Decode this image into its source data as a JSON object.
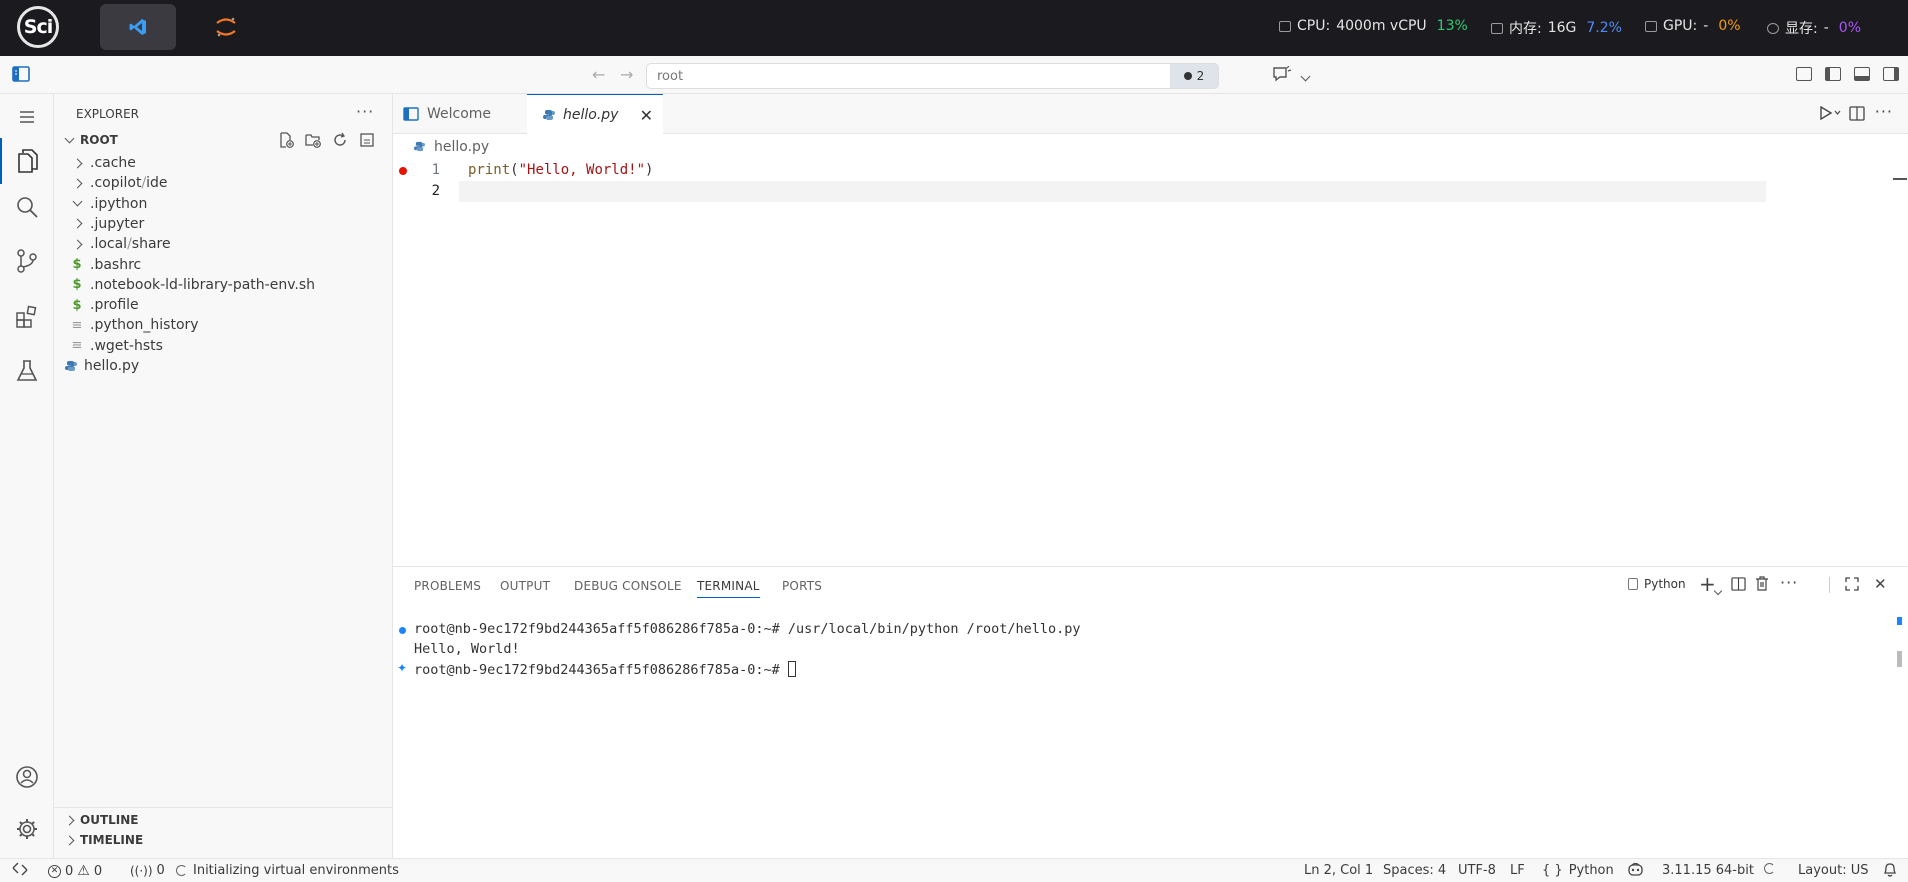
{
  "topbar": {
    "logo": "Sci",
    "cpu": {
      "label": "CPU:",
      "value": "4000m vCPU",
      "pct": "13%",
      "color": "#2ecc71"
    },
    "mem": {
      "label": "内存:",
      "value": "16G",
      "pct": "7.2%",
      "color": "#4d8bf7"
    },
    "gpu": {
      "label": "GPU:",
      "value": "-",
      "pct": "0%",
      "color": "#f39c12"
    },
    "vram": {
      "label": "显存:",
      "value": "-",
      "pct": "0%",
      "color": "#a855f7"
    }
  },
  "titlebar": {
    "search_text": "root",
    "badge_count": "2"
  },
  "sidebar": {
    "title": "EXPLORER",
    "root": "ROOT",
    "items": [
      {
        "label": ".cache",
        "kind": "folder"
      },
      {
        "label": ".copilot",
        "sub": "ide",
        "kind": "folder"
      },
      {
        "label": ".ipython",
        "kind": "folder-open"
      },
      {
        "label": ".jupyter",
        "kind": "folder"
      },
      {
        "label": ".local",
        "sub": "share",
        "kind": "folder"
      },
      {
        "label": ".bashrc",
        "kind": "shell"
      },
      {
        "label": ".notebook-ld-library-path-env.sh",
        "kind": "shell"
      },
      {
        "label": ".profile",
        "kind": "shell"
      },
      {
        "label": ".python_history",
        "kind": "text"
      },
      {
        "label": ".wget-hsts",
        "kind": "text"
      },
      {
        "label": "hello.py",
        "kind": "python"
      }
    ],
    "outline": "OUTLINE",
    "timeline": "TIMELINE"
  },
  "tabs": [
    {
      "label": "Welcome"
    },
    {
      "label": "hello.py"
    }
  ],
  "breadcrumb": "hello.py",
  "editor": {
    "lines": [
      {
        "num": "1",
        "code_fn": "print",
        "code_open": "(",
        "code_str": "\"Hello, World!\"",
        "code_close": ")"
      },
      {
        "num": "2"
      }
    ]
  },
  "panel": {
    "tabs": [
      "PROBLEMS",
      "OUTPUT",
      "DEBUG CONSOLE",
      "TERMINAL",
      "PORTS"
    ],
    "terminal_profile": "Python",
    "terminal": [
      "root@nb-9ec172f9bd244365aff5f086286f785a-0:~# /usr/local/bin/python /root/hello.py",
      "Hello, World!",
      "root@nb-9ec172f9bd244365aff5f086286f785a-0:~# "
    ]
  },
  "statusbar": {
    "errors": "0",
    "warnings": "0",
    "ports": "0",
    "status_text": "Initializing virtual environments",
    "position": "Ln 2, Col 1",
    "spaces": "Spaces: 4",
    "encoding": "UTF-8",
    "eol": "LF",
    "language": "Python",
    "interpreter": "3.11.15 64-bit",
    "layout": "Layout: US"
  }
}
